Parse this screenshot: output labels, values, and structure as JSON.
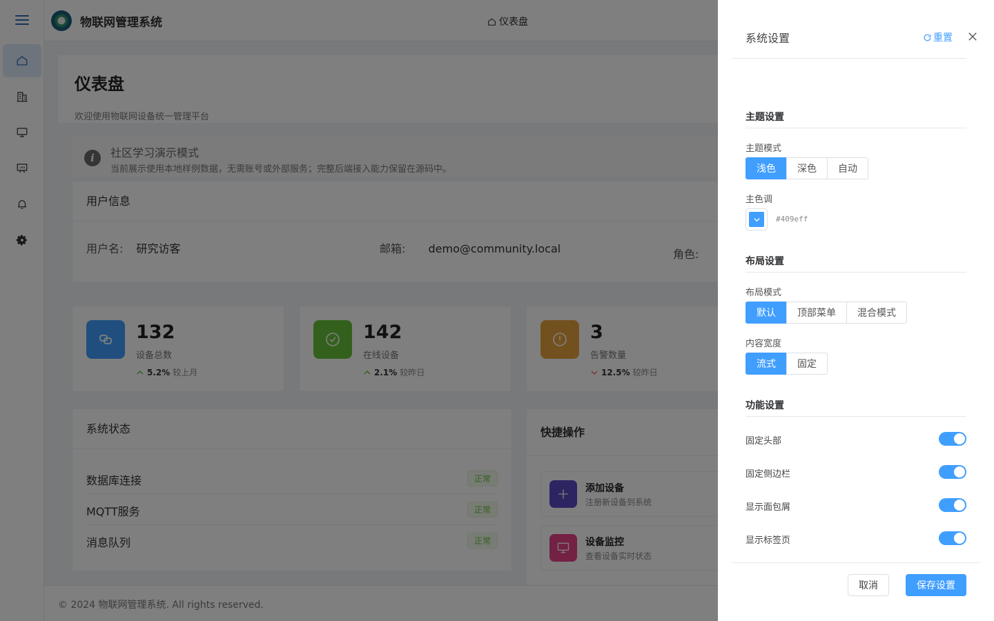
{
  "app": {
    "title": "物联网管理系统",
    "breadcrumb": "仪表盘"
  },
  "colors": {
    "accent": "#409eff",
    "success": "#67c23a",
    "warning": "#e6a23c",
    "overlay": "rgba(0,0,0,0.5)"
  },
  "sidebar": {
    "items": [
      {
        "icon": "home-icon",
        "active": true
      },
      {
        "icon": "building-icon"
      },
      {
        "icon": "monitor-icon"
      },
      {
        "icon": "presentation-icon"
      },
      {
        "icon": "bell-icon"
      },
      {
        "icon": "gear-icon"
      }
    ]
  },
  "page": {
    "title": "仪表盘",
    "subtitle": "欢迎使用物联网设备统一管理平台"
  },
  "notice": {
    "title": "社区学习演示模式",
    "description": "当前展示使用本地样例数据，无需账号或外部服务；完整后端接入能力保留在源码中。"
  },
  "user_info": {
    "title": "用户信息",
    "username_label": "用户名:",
    "username": "研究访客",
    "email_label": "邮箱:",
    "email": "demo@community.local",
    "role_label": "角色:"
  },
  "stats": [
    {
      "value": "132",
      "label": "设备总数",
      "trend_pct": "5.2%",
      "trend_text": "较上月",
      "direction": "up",
      "color": "#409eff",
      "icon": "link-icon"
    },
    {
      "value": "142",
      "label": "在线设备",
      "trend_pct": "2.1%",
      "trend_text": "较昨日",
      "direction": "up",
      "color": "#67c23a",
      "icon": "check-circle-icon"
    },
    {
      "value": "3",
      "label": "告警数量",
      "trend_pct": "12.5%",
      "trend_text": "较昨日",
      "direction": "down",
      "color": "#e6a23c",
      "icon": "warning-icon"
    }
  ],
  "system_status": {
    "title": "系统状态",
    "rows": [
      {
        "name": "数据库连接",
        "status": "正常"
      },
      {
        "name": "MQTT服务",
        "status": "正常"
      },
      {
        "name": "消息队列",
        "status": "正常"
      }
    ]
  },
  "quick_actions": {
    "title": "快捷操作",
    "items": [
      {
        "title": "添加设备",
        "desc": "注册新设备到系统",
        "icon": "plus-icon"
      },
      {
        "title": "设备监控",
        "desc": "查看设备实时状态",
        "icon": "monitor-icon"
      }
    ]
  },
  "footer": {
    "text": "© 2024 物联网管理系统. All rights reserved."
  },
  "drawer": {
    "title": "系统设置",
    "reset_label": "重置",
    "theme": {
      "section": "主题设置",
      "mode_label": "主题模式",
      "modes": [
        "浅色",
        "深色",
        "自动"
      ],
      "mode_selected": "浅色",
      "color_label": "主色调",
      "color_value": "#409eff"
    },
    "layout": {
      "section": "布局设置",
      "mode_label": "布局模式",
      "modes": [
        "默认",
        "顶部菜单",
        "混合模式"
      ],
      "mode_selected": "默认",
      "width_label": "内容宽度",
      "widths": [
        "流式",
        "固定"
      ],
      "width_selected": "流式"
    },
    "features": {
      "section": "功能设置",
      "toggles": [
        {
          "label": "固定头部",
          "on": true
        },
        {
          "label": "固定侧边栏",
          "on": true
        },
        {
          "label": "显示面包屑",
          "on": true
        },
        {
          "label": "显示标签页",
          "on": true
        }
      ]
    },
    "cancel_label": "取消",
    "save_label": "保存设置"
  }
}
